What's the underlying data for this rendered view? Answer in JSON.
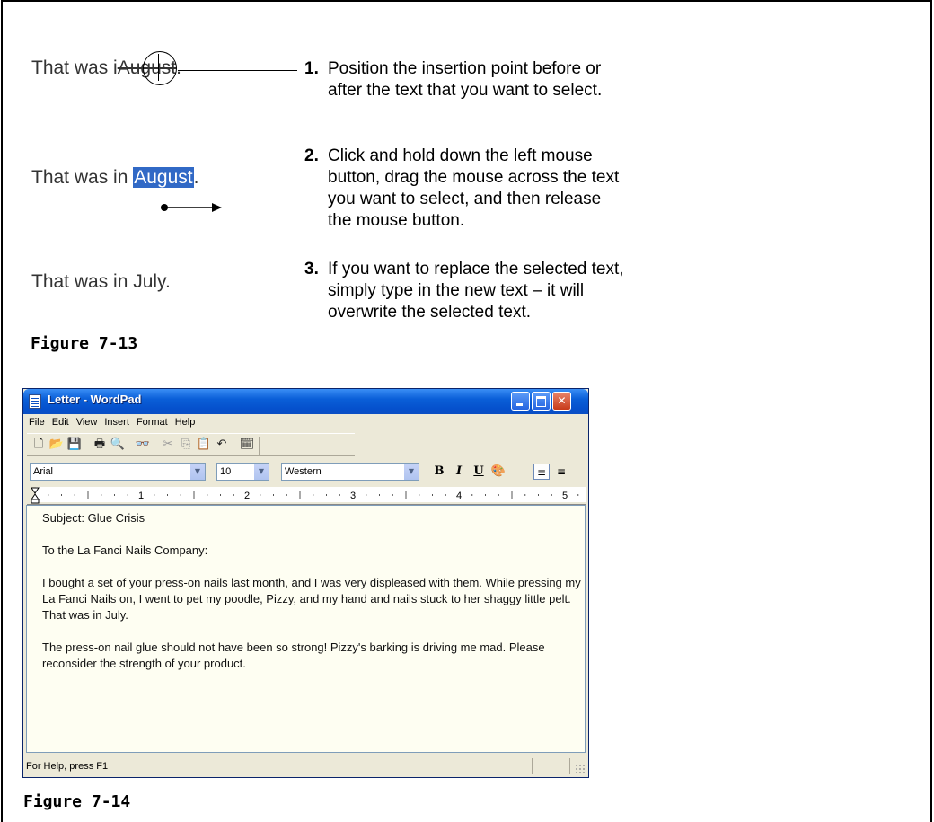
{
  "examples": [
    {
      "prefix": "That was i",
      "word": "August",
      "suffix": "."
    },
    {
      "prefix": "That was in ",
      "word": "August",
      "suffix": "."
    },
    {
      "prefix": "That was in July",
      "word": "",
      "suffix": "."
    }
  ],
  "steps": [
    {
      "num": "1.",
      "lines": [
        "Position the insertion point before or",
        "after the text that you want to select."
      ]
    },
    {
      "num": "2.",
      "lines": [
        "Click and hold down the left mouse",
        "button, drag the mouse across the text",
        "you want to select, and then release",
        "the mouse button."
      ]
    },
    {
      "num": "3.",
      "lines": [
        "If you want to replace the selected text,",
        "simply type in the new text – it will",
        "overwrite the selected text."
      ]
    }
  ],
  "figure_captions": [
    "Figure 7-13",
    "Figure 7-14"
  ],
  "wordpad": {
    "title": "Letter - WordPad",
    "menu": [
      "File",
      "Edit",
      "View",
      "Insert",
      "Format",
      "Help"
    ],
    "font": "Arial",
    "size": "10",
    "script": "Western",
    "ruler_labels": [
      "1",
      "2",
      "3",
      "4",
      "5"
    ],
    "paragraphs": [
      "Subject: Glue Crisis",
      "To the La Fanci Nails Company:",
      "I bought a set of your press-on nails last month, and I was very displeased with them. While pressing my La Fanci Nails on, I went to pet my poodle, Pizzy, and my hand and nails stuck to her shaggy little pelt. That was in July.",
      "The press-on nail glue should not have been so strong! Pizzy's barking is driving me mad. Please reconsider the strength of your product."
    ],
    "status": "For Help, press F1"
  }
}
